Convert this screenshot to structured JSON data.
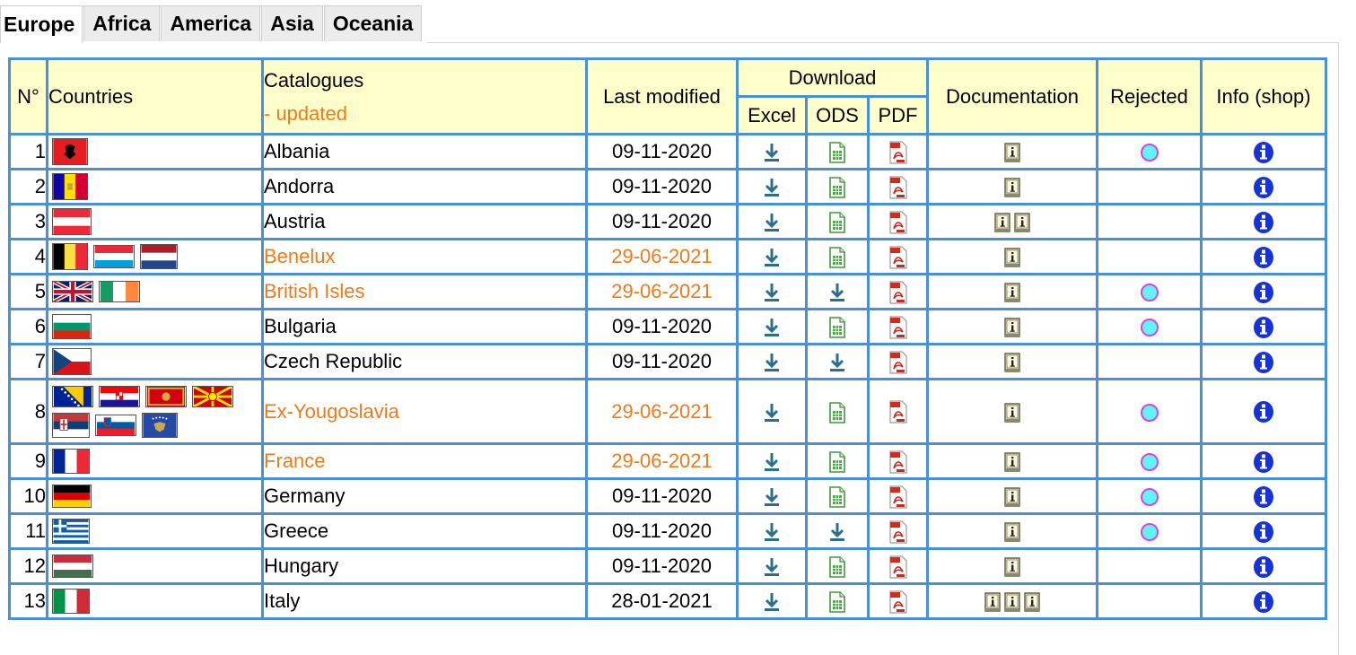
{
  "tabs": [
    {
      "label": "Europe",
      "active": true
    },
    {
      "label": "Africa",
      "active": false
    },
    {
      "label": "America",
      "active": false
    },
    {
      "label": "Asia",
      "active": false
    },
    {
      "label": "Oceania",
      "active": false
    }
  ],
  "headers": {
    "num": "N°",
    "countries": "Countries",
    "catalogues": "Catalogues",
    "catalogues_sub": "- updated",
    "last_modified": "Last modified",
    "download": "Download",
    "excel": "Excel",
    "ods": "ODS",
    "pdf": "PDF",
    "documentation": "Documentation",
    "rejected": "Rejected",
    "info": "Info (shop)"
  },
  "colors": {
    "updated": "#f07a1a",
    "header_bg": "#ffffcc",
    "border": "#4a90d9"
  },
  "rows": [
    {
      "num": "1",
      "name": "Albania",
      "date": "09-11-2020",
      "updated": false,
      "flags": [
        "albania"
      ],
      "ods": "spreadsheet",
      "docs": 1,
      "rejected": true
    },
    {
      "num": "2",
      "name": "Andorra",
      "date": "09-11-2020",
      "updated": false,
      "flags": [
        "andorra"
      ],
      "ods": "spreadsheet",
      "docs": 1,
      "rejected": false
    },
    {
      "num": "3",
      "name": "Austria",
      "date": "09-11-2020",
      "updated": false,
      "flags": [
        "austria"
      ],
      "ods": "spreadsheet",
      "docs": 2,
      "rejected": false
    },
    {
      "num": "4",
      "name": "Benelux",
      "date": "29-06-2021",
      "updated": true,
      "flags": [
        "belgium",
        "luxembourg",
        "netherlands"
      ],
      "ods": "spreadsheet",
      "docs": 1,
      "rejected": false
    },
    {
      "num": "5",
      "name": "British Isles",
      "date": "29-06-2021",
      "updated": true,
      "flags": [
        "uk",
        "ireland"
      ],
      "ods": "download",
      "docs": 1,
      "rejected": true
    },
    {
      "num": "6",
      "name": "Bulgaria",
      "date": "09-11-2020",
      "updated": false,
      "flags": [
        "bulgaria"
      ],
      "ods": "spreadsheet",
      "docs": 1,
      "rejected": true
    },
    {
      "num": "7",
      "name": "Czech Republic",
      "date": "09-11-2020",
      "updated": false,
      "flags": [
        "czech"
      ],
      "ods": "download",
      "docs": 1,
      "rejected": false
    },
    {
      "num": "8",
      "name": "Ex-Yougoslavia",
      "date": "29-06-2021",
      "updated": true,
      "flags": [
        "bosnia",
        "croatia",
        "montenegro",
        "macedonia",
        "serbia",
        "slovenia",
        "kosovo"
      ],
      "ods": "spreadsheet",
      "docs": 1,
      "rejected": true
    },
    {
      "num": "9",
      "name": "France",
      "date": "29-06-2021",
      "updated": true,
      "flags": [
        "france"
      ],
      "ods": "spreadsheet",
      "docs": 1,
      "rejected": true
    },
    {
      "num": "10",
      "name": "Germany",
      "date": "09-11-2020",
      "updated": false,
      "flags": [
        "germany"
      ],
      "ods": "spreadsheet",
      "docs": 1,
      "rejected": true
    },
    {
      "num": "11",
      "name": "Greece",
      "date": "09-11-2020",
      "updated": false,
      "flags": [
        "greece"
      ],
      "ods": "download",
      "docs": 1,
      "rejected": true
    },
    {
      "num": "12",
      "name": "Hungary",
      "date": "09-11-2020",
      "updated": false,
      "flags": [
        "hungary"
      ],
      "ods": "spreadsheet",
      "docs": 1,
      "rejected": false
    },
    {
      "num": "13",
      "name": "Italy",
      "date": "28-01-2021",
      "updated": false,
      "flags": [
        "italy"
      ],
      "ods": "spreadsheet",
      "docs": 3,
      "rejected": false
    }
  ]
}
